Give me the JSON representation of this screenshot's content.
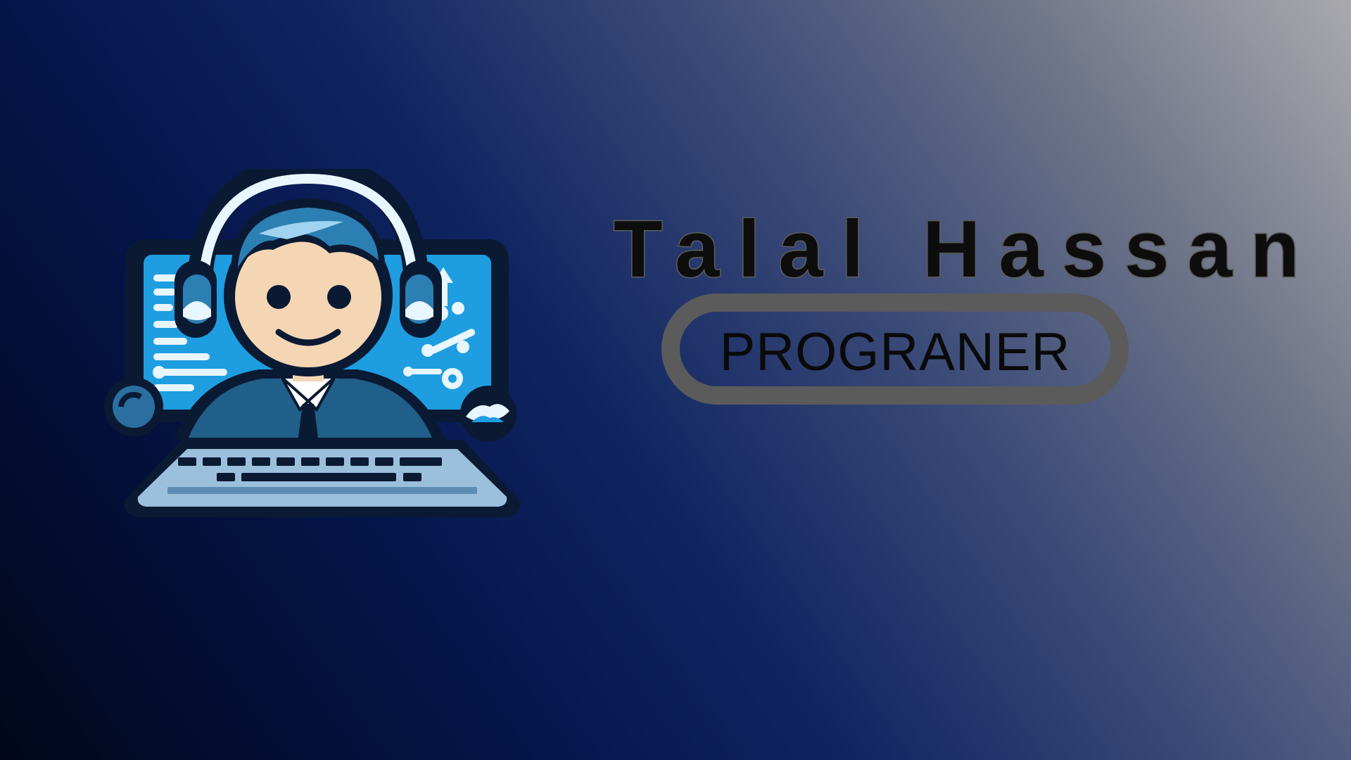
{
  "profile": {
    "name": "Talal Hassan",
    "role": "PROGRANER"
  },
  "logo": {
    "icon": "programmer-mascot-icon"
  },
  "colors": {
    "background_dark": "#02071a",
    "background_mid": "#0f2461",
    "background_light": "#a9a9ad",
    "badge_border": "#5b5b5b",
    "screen_blue": "#1e9ee0",
    "text": "#0d0d0d"
  }
}
